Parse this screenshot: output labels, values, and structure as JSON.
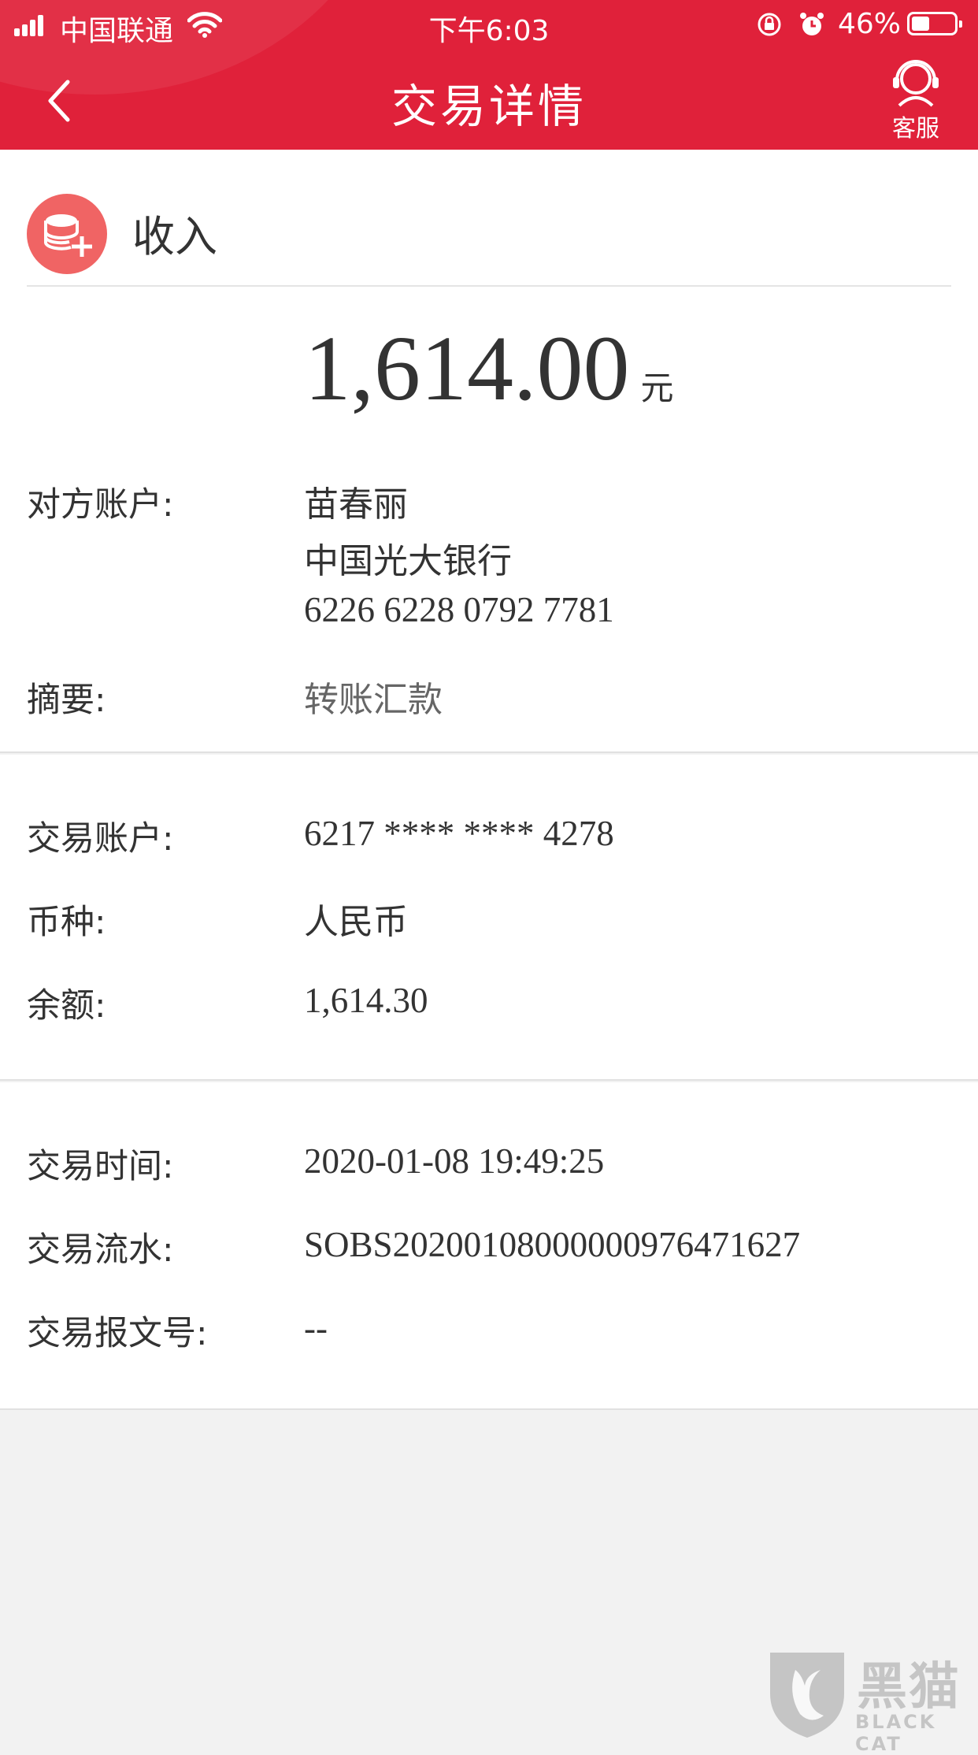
{
  "status_bar": {
    "carrier": "中国联通",
    "time": "下午6:03",
    "battery_percent": "46%",
    "battery_level": 0.46
  },
  "nav": {
    "title": "交易详情",
    "service_label": "客服"
  },
  "transaction": {
    "type": "收入",
    "amount": "1,614.00",
    "unit": "元",
    "counterparty": {
      "label": "对方账户:",
      "name": "苗春丽",
      "bank": "中国光大银行",
      "account": "6226 6228 0792 7781"
    },
    "summary": {
      "label": "摘要:",
      "value": "转账汇款"
    },
    "account": {
      "label": "交易账户:",
      "value": "6217 **** **** 4278"
    },
    "currency": {
      "label": "币种:",
      "value": "人民币"
    },
    "balance": {
      "label": "余额:",
      "value": "1,614.30"
    },
    "time": {
      "label": "交易时间:",
      "value": "2020-01-08 19:49:25"
    },
    "serial": {
      "label": "交易流水:",
      "value": "SOBS20200108000000976471627"
    },
    "message_no": {
      "label": "交易报文号:",
      "value": "--"
    }
  },
  "watermark": {
    "text": "黑猫",
    "sub": "BLACK CAT"
  },
  "colors": {
    "brand": "#e0213a",
    "icon": "#f06464"
  }
}
